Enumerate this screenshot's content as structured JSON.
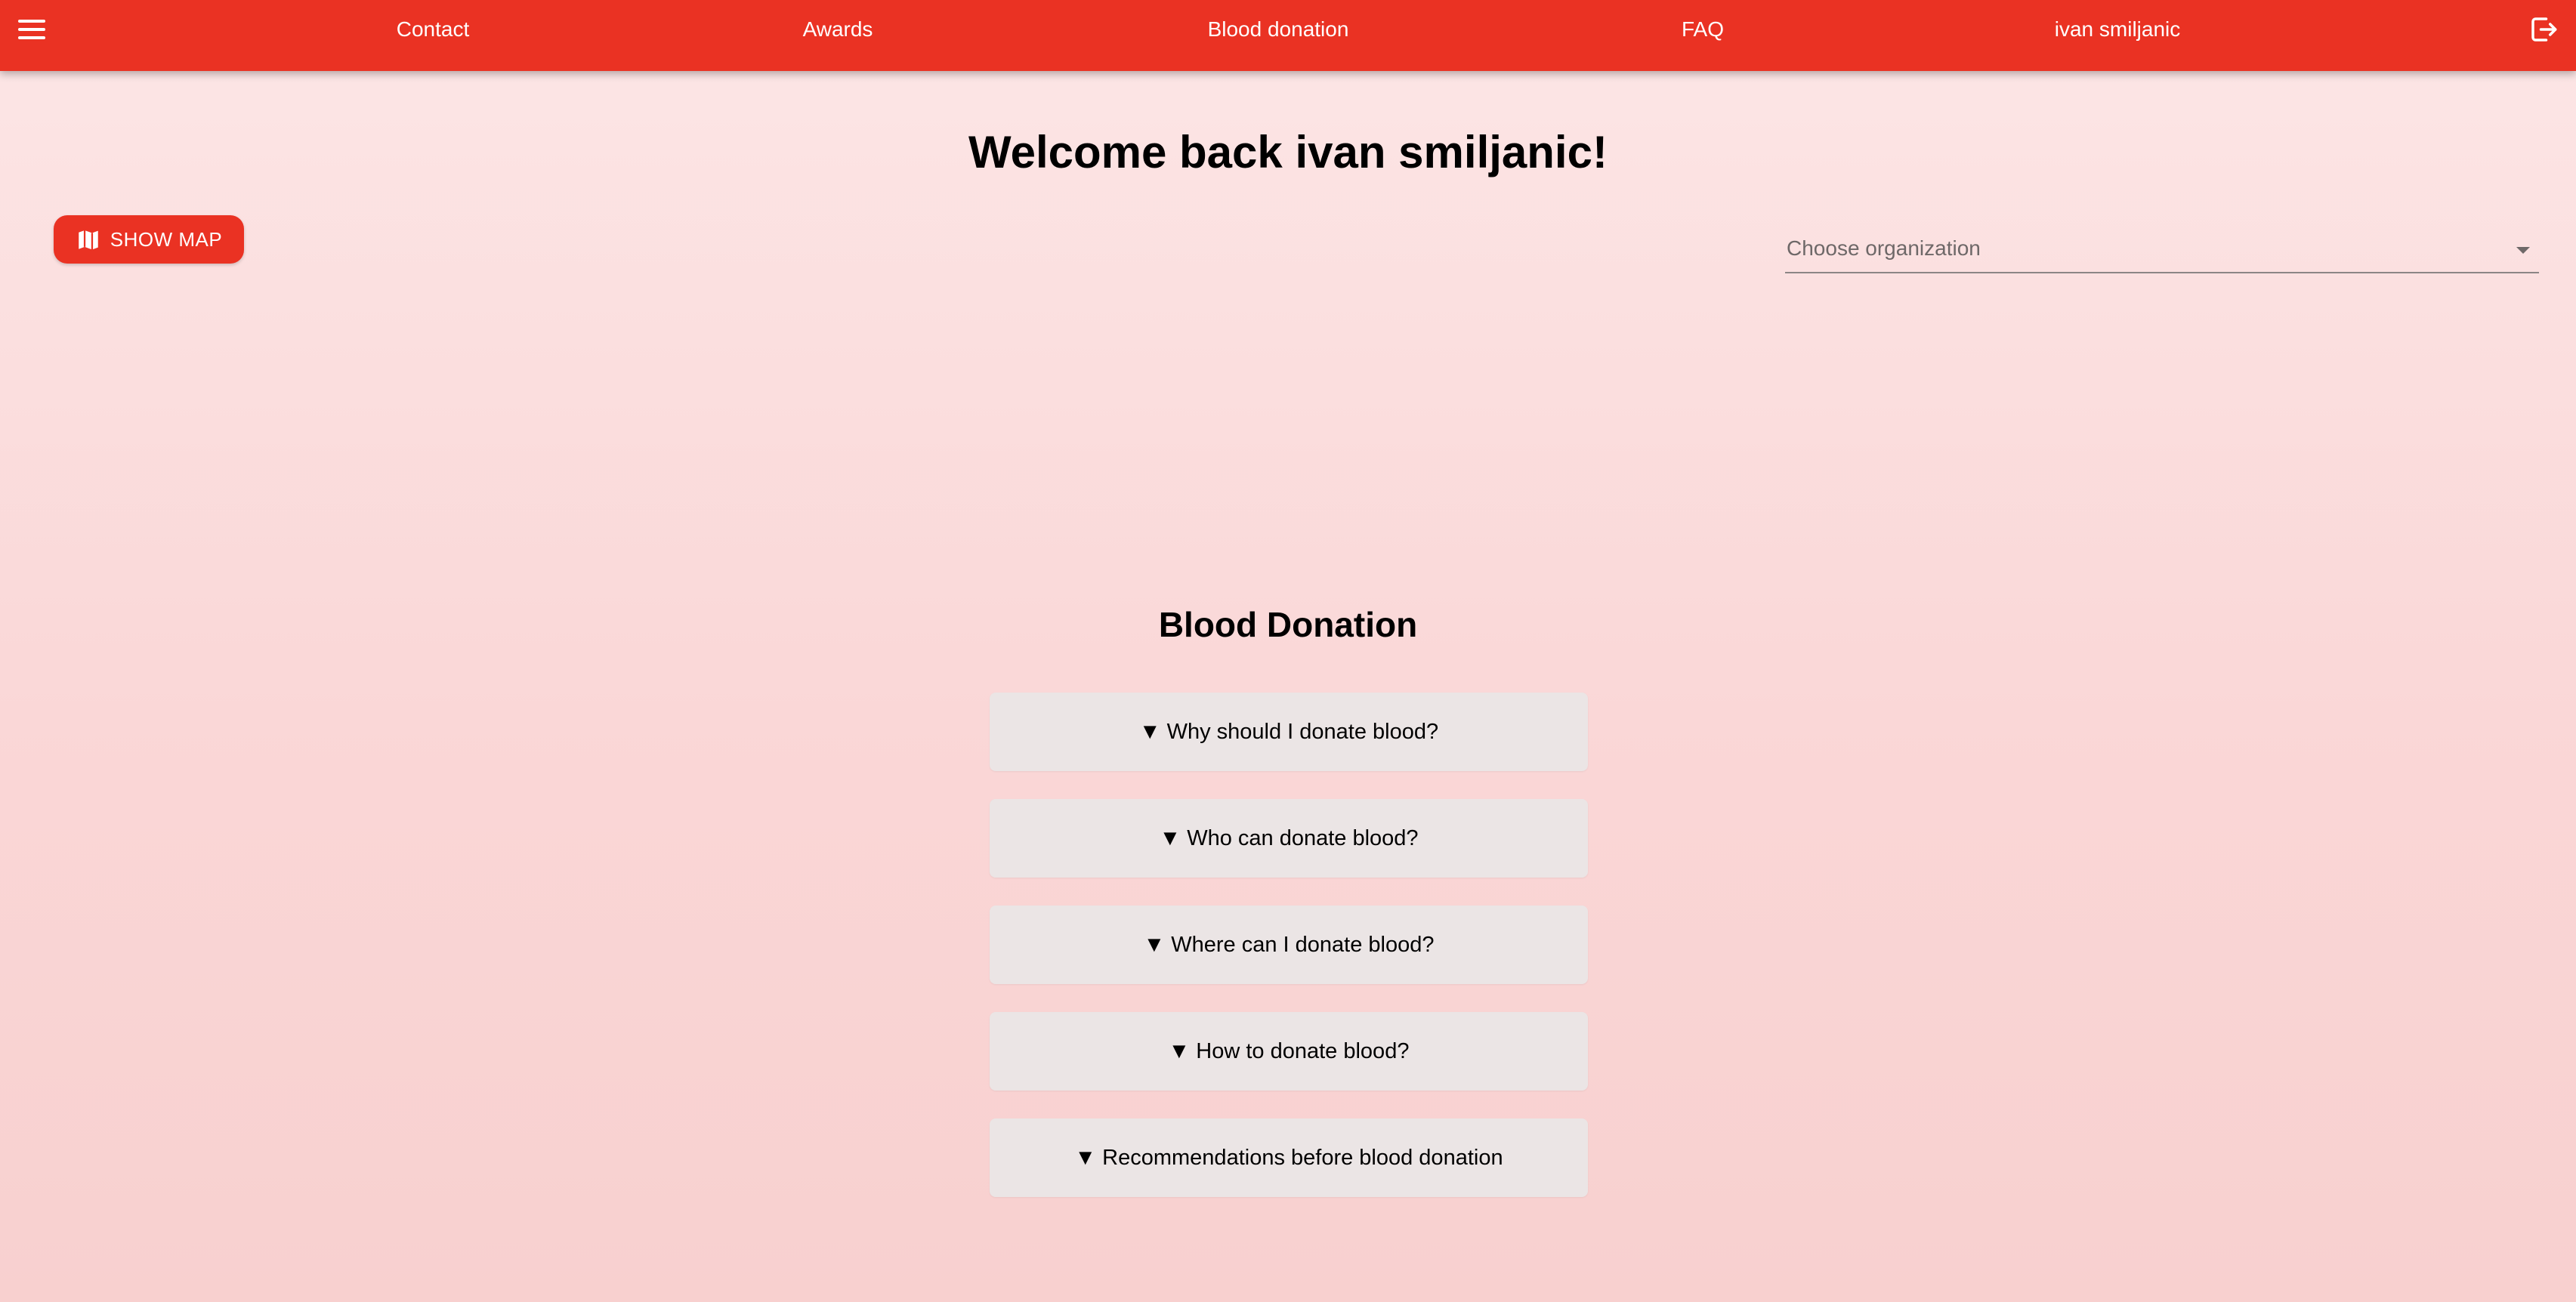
{
  "header": {
    "menu_icon": "hamburger-menu-icon",
    "nav": [
      {
        "label": "Contact"
      },
      {
        "label": "Awards"
      },
      {
        "label": "Blood donation"
      },
      {
        "label": "FAQ"
      },
      {
        "label": "ivan smiljanic"
      }
    ],
    "logout_icon": "logout-icon"
  },
  "main": {
    "welcome": "Welcome back ivan smiljanic!",
    "show_map_label": "SHOW MAP",
    "show_map_icon": "map-icon",
    "organization_select": {
      "placeholder": "Choose organization",
      "icon": "dropdown-arrow-icon"
    }
  },
  "faq": {
    "title": "Blood Donation",
    "items": [
      {
        "label": "▼ Why should I donate blood?"
      },
      {
        "label": "▼ Who can donate blood?"
      },
      {
        "label": "▼ Where can I donate blood?"
      },
      {
        "label": "▼ How to donate blood?"
      },
      {
        "label": "▼ Recommendations before blood donation"
      }
    ]
  },
  "colors": {
    "accent": "#ea3223",
    "background_top": "#fce6e6",
    "background_bottom": "#f8d0cf",
    "faq_item_bg": "#ebe5e5"
  }
}
